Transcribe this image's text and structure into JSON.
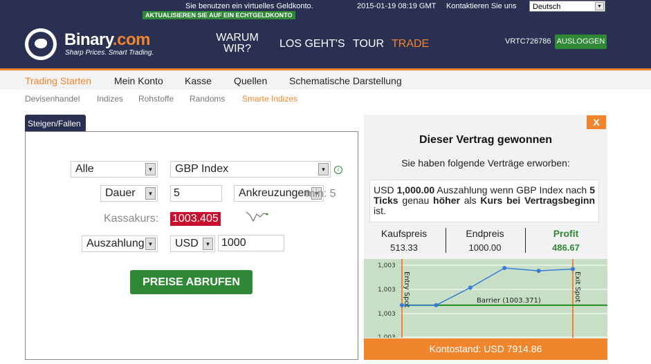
{
  "topbar": {
    "virtual_notice": "Sie benutzen ein virtuelles Geldkonto.",
    "upgrade_label": "AKTUALISIEREN SIE AUF EIN ECHTGELDKONTO",
    "datetime": "2015-01-19 08:19 GMT",
    "contact_label": "Kontaktieren Sie uns",
    "language": "Deutsch"
  },
  "header": {
    "brand_name": "Binary",
    "brand_suffix": ".com",
    "tagline": "Sharp Prices. Smart Trading.",
    "nav": {
      "why": "WARUM WIR?",
      "start": "LOS GEHT'S",
      "tour": "TOUR",
      "trade": "TRADE"
    },
    "account_id": "VRTC726786",
    "logout_label": "AUSLOGGEN"
  },
  "menu": {
    "items": [
      "Trading Starten",
      "Mein Konto",
      "Kasse",
      "Quellen",
      "Schematische Darstellung"
    ],
    "sub_items": [
      "Devisenhandel",
      "Indizes",
      "Rohstoffe",
      "Randoms",
      "Smarte Indizes"
    ]
  },
  "form": {
    "tab_label": "Steigen/Fallen",
    "market_filter": "Alle",
    "underlying": "GBP Index",
    "duration_type": "Dauer",
    "duration_value": "5",
    "duration_unit": "Ankreuzungen",
    "min_text": "min: 5",
    "spot_label": "Kassakurs:",
    "spot_value": "1003.405",
    "payout_type": "Auszahlung",
    "currency": "USD",
    "amount": "1000",
    "get_price_label": "PREISE ABRUFEN"
  },
  "result": {
    "close_label": "X",
    "title": "Dieser Vertrag gewonnen",
    "subtitle": "Sie haben folgende Verträge erworben:",
    "desc_currency": "USD",
    "desc_amount": "1,000.00",
    "desc_mid1": "Auszahlung wenn GBP Index nach",
    "desc_ticks": "5 Ticks",
    "desc_mid2": "genau",
    "desc_higher": "höher",
    "desc_mid3": "als",
    "desc_entry": "Kurs bei Vertragsbeginn",
    "desc_end": "ist.",
    "buy_price_label": "Kaufspreis",
    "buy_price": "513.33",
    "end_price_label": "Endpreis",
    "end_price": "1000.00",
    "profit_label": "Profit",
    "profit": "486.67",
    "balance": "Kontostand: USD 7914.86"
  },
  "chart_data": {
    "type": "line",
    "y_tick_labels": [
      "1,003",
      "1,003",
      "1,003",
      "1,003"
    ],
    "ticks": [
      1,
      2,
      3,
      4,
      5,
      6
    ],
    "values": [
      1003.371,
      1003.371,
      1003.42,
      1003.475,
      1003.467,
      1003.472
    ],
    "barrier": 1003.371,
    "barrier_label": "Barrier (1003.371)",
    "entry_label": "Entry Spot",
    "exit_label": "Exit Spot",
    "ylim": [
      1003.28,
      1003.5
    ],
    "colors": {
      "line": "#3a7bd5",
      "barrier": "#1c8c1c",
      "markers": "#f0852d",
      "background": "#c6dfc6"
    }
  }
}
